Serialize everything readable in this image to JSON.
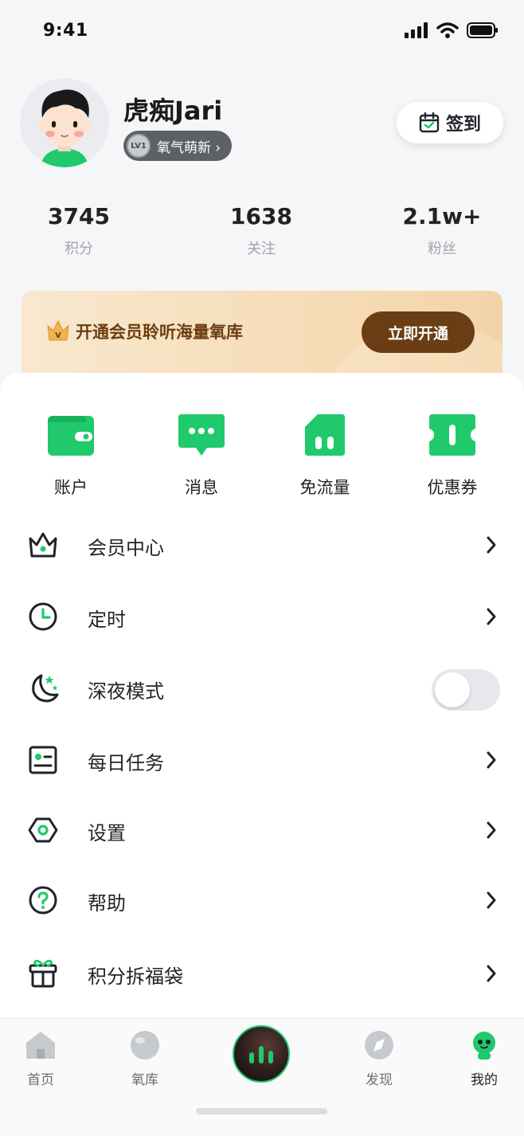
{
  "status_bar": {
    "time": "9:41"
  },
  "profile": {
    "nickname": "虎痴Jari",
    "level_badge_text": "LV1",
    "level_title": "氧气萌新 ›",
    "checkin_label": "签到"
  },
  "stats": [
    {
      "value": "3745",
      "label": "积分"
    },
    {
      "value": "1638",
      "label": "关注"
    },
    {
      "value": "2.1w+",
      "label": "粉丝"
    }
  ],
  "vip": {
    "crown_letter": "V",
    "text": "开通会员聆听海量氧库",
    "button_label": "立即开通"
  },
  "quick_actions": [
    {
      "label": "账户",
      "icon": "wallet-icon"
    },
    {
      "label": "消息",
      "icon": "message-icon"
    },
    {
      "label": "免流量",
      "icon": "sim-card-icon"
    },
    {
      "label": "优惠券",
      "icon": "coupon-icon"
    }
  ],
  "menu": [
    {
      "label": "会员中心",
      "icon": "crown-icon"
    },
    {
      "label": "定时",
      "icon": "clock-icon"
    },
    {
      "label": "深夜模式",
      "icon": "moon-icon",
      "toggle_on": false
    },
    {
      "label": "每日任务",
      "icon": "task-card-icon"
    },
    {
      "label": "设置",
      "icon": "hexagon-settings-icon"
    },
    {
      "label": "帮助",
      "icon": "help-icon"
    },
    {
      "label": "积分拆福袋",
      "icon": "gift-icon"
    }
  ],
  "tabbar": [
    {
      "label": "首页",
      "icon": "home-icon"
    },
    {
      "label": "氧库",
      "icon": "planet-icon"
    },
    {
      "label": "发现",
      "icon": "compass-icon"
    },
    {
      "label": "我的",
      "icon": "mascot-icon",
      "active": true
    }
  ],
  "colors": {
    "accent_green": "#1fc96c",
    "vip_brown": "#6b3d14",
    "vip_gold": "#f3d4a7"
  }
}
